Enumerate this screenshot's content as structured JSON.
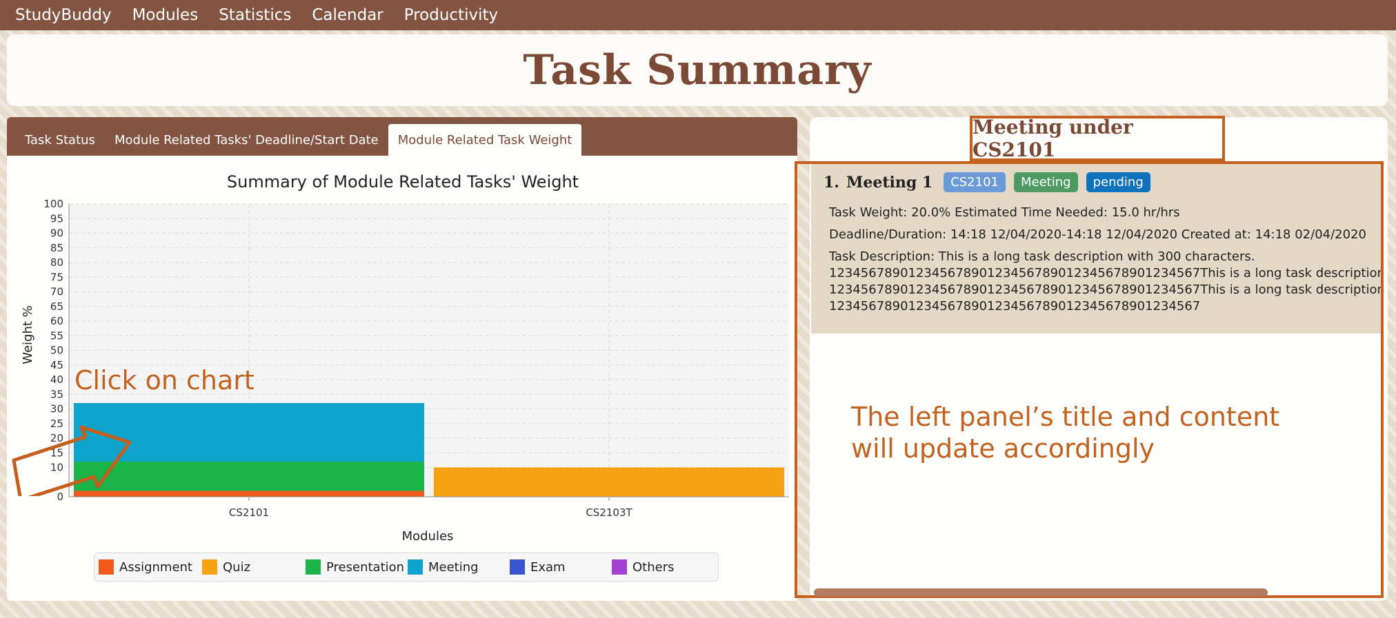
{
  "menubar": {
    "items": [
      "StudyBuddy",
      "Modules",
      "Statistics",
      "Calendar",
      "Productivity"
    ]
  },
  "page_title": "Task Summary",
  "tabs": [
    {
      "label": "Task Status",
      "active": false
    },
    {
      "label": "Module Related Tasks' Deadline/Start Date",
      "active": false
    },
    {
      "label": "Module Related Task Weight",
      "active": true
    }
  ],
  "chart_data": {
    "type": "bar",
    "stacked": true,
    "title": "Summary of Module Related Tasks' Weight",
    "xlabel": "Modules",
    "ylabel": "Weight %",
    "ylim": [
      0,
      100
    ],
    "yticks": [
      0,
      10,
      15,
      20,
      25,
      30,
      35,
      40,
      45,
      50,
      55,
      60,
      65,
      70,
      75,
      80,
      85,
      90,
      95,
      100
    ],
    "categories": [
      "CS2101",
      "CS2103T"
    ],
    "series": [
      {
        "name": "Assignment",
        "color": "#f3581c",
        "values": [
          2,
          0
        ]
      },
      {
        "name": "Quiz",
        "color": "#f8a313",
        "values": [
          0,
          10
        ]
      },
      {
        "name": "Presentation",
        "color": "#1cb448",
        "values": [
          10,
          0
        ]
      },
      {
        "name": "Meeting",
        "color": "#0ea4cb",
        "values": [
          20,
          0
        ]
      },
      {
        "name": "Exam",
        "color": "#3b55d0",
        "values": [
          0,
          0
        ]
      },
      {
        "name": "Others",
        "color": "#a441d3",
        "values": [
          0,
          0
        ]
      }
    ],
    "grid": true,
    "legend_position": "bottom"
  },
  "annotations": {
    "click_on_chart": "Click on chart",
    "update_note": "The left panel’s title and content will update accordingly"
  },
  "right_panel": {
    "title": "Meeting under CS2101",
    "tasks": [
      {
        "index": "1.",
        "name": "Meeting 1",
        "tags": [
          {
            "label": "CS2101",
            "color": "#6b9bd6"
          },
          {
            "label": "Meeting",
            "color": "#4d9a62"
          },
          {
            "label": "pending",
            "color": "#0f72bb"
          }
        ],
        "weight_line": "Task Weight: 20.0%   Estimated Time Needed: 15.0 hr/hrs",
        "deadline_line": "Deadline/Duration: 14:18 12/04/2020-14:18 12/04/2020   Created at: 14:18 02/04/2020",
        "description_lines": [
          "Task Description: This is a long task description with 300 characters.",
          "12345678901234567890123456789012345678901234567This is a long task description w",
          "12345678901234567890123456789012345678901234567This is a long task description w",
          "12345678901234567890123456789012345678901234567"
        ]
      }
    ]
  }
}
